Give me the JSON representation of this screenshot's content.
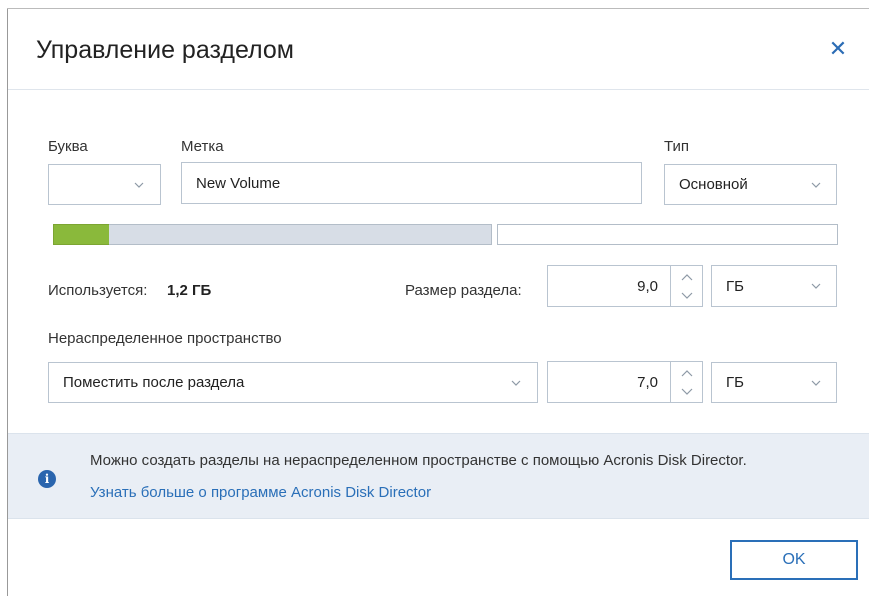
{
  "dialog": {
    "title": "Управление разделом",
    "close_icon": "close-icon"
  },
  "fields": {
    "letter_label": "Буква",
    "letter_value": "",
    "label_label": "Метка",
    "label_value": "New Volume",
    "type_label": "Тип",
    "type_value": "Основной"
  },
  "usage_bar": {
    "used_fraction": 0.13,
    "partition_fraction": 0.56,
    "used_color": "#8ab93b",
    "partition_color": "#d7dde6"
  },
  "usage": {
    "used_label": "Используется:",
    "used_value": "1,2 ГБ",
    "size_label": "Размер раздела:",
    "size_value": "9,0",
    "size_unit": "ГБ"
  },
  "unallocated": {
    "label": "Нераспределенное пространство",
    "placement_value": "Поместить после раздела",
    "amount_value": "7,0",
    "amount_unit": "ГБ"
  },
  "info": {
    "icon": "info-icon",
    "message": "Можно создать разделы на нераспределенном пространстве с помощью Acronis Disk Director.",
    "link": "Узнать больше о программе Acronis Disk Director"
  },
  "footer": {
    "ok_label": "OK"
  },
  "colors": {
    "accent": "#2a6fb8",
    "info_band": "#e9eef5"
  }
}
